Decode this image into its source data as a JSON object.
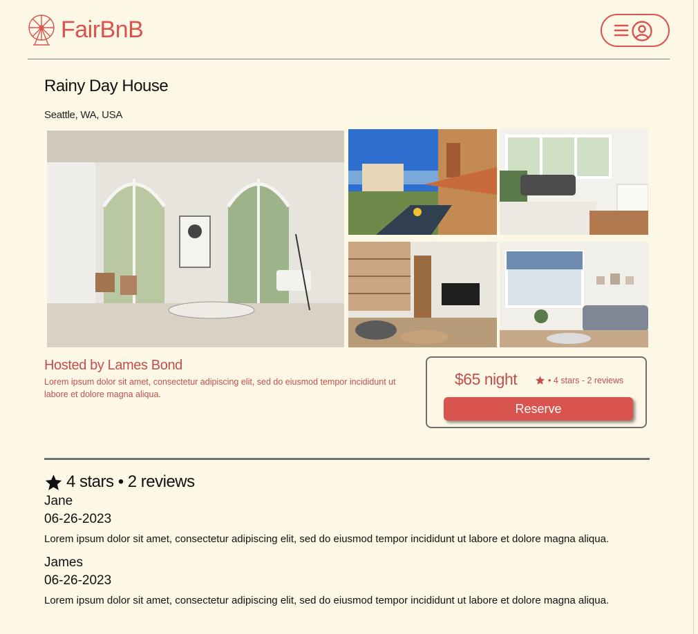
{
  "brand": {
    "name": "FairBnB",
    "color": "#d9534f"
  },
  "header": {
    "menu_icon": "hamburger-icon",
    "user_icon": "user-circle-icon"
  },
  "listing": {
    "title": "Rainy Day House",
    "location": "Seattle, WA, USA",
    "photos": [
      "living-room-main",
      "rooftop-terrace",
      "bright-living-room",
      "modern-lounge",
      "blue-sofa-room"
    ]
  },
  "host": {
    "title": "Hosted by Lames Bond",
    "description": "Lorem ipsum dolor sit amet, consectetur adipiscing elit, sed do eiusmod tempor incididunt ut labore et dolore magna aliqua."
  },
  "booking": {
    "price": "$65 night",
    "rating_summary": "• 4 stars - 2 reviews",
    "reserve_label": "Reserve"
  },
  "reviews": {
    "summary": "4 stars • 2 reviews",
    "items": [
      {
        "name": "Jane",
        "date": "06-26-2023",
        "text": "Lorem ipsum dolor sit amet, consectetur adipiscing elit, sed do eiusmod tempor incididunt ut labore et dolore magna aliqua."
      },
      {
        "name": "James",
        "date": "06-26-2023",
        "text": "Lorem ipsum dolor sit amet, consectetur adipiscing elit, sed do eiusmod tempor incididunt ut labore et dolore magna aliqua."
      }
    ]
  }
}
